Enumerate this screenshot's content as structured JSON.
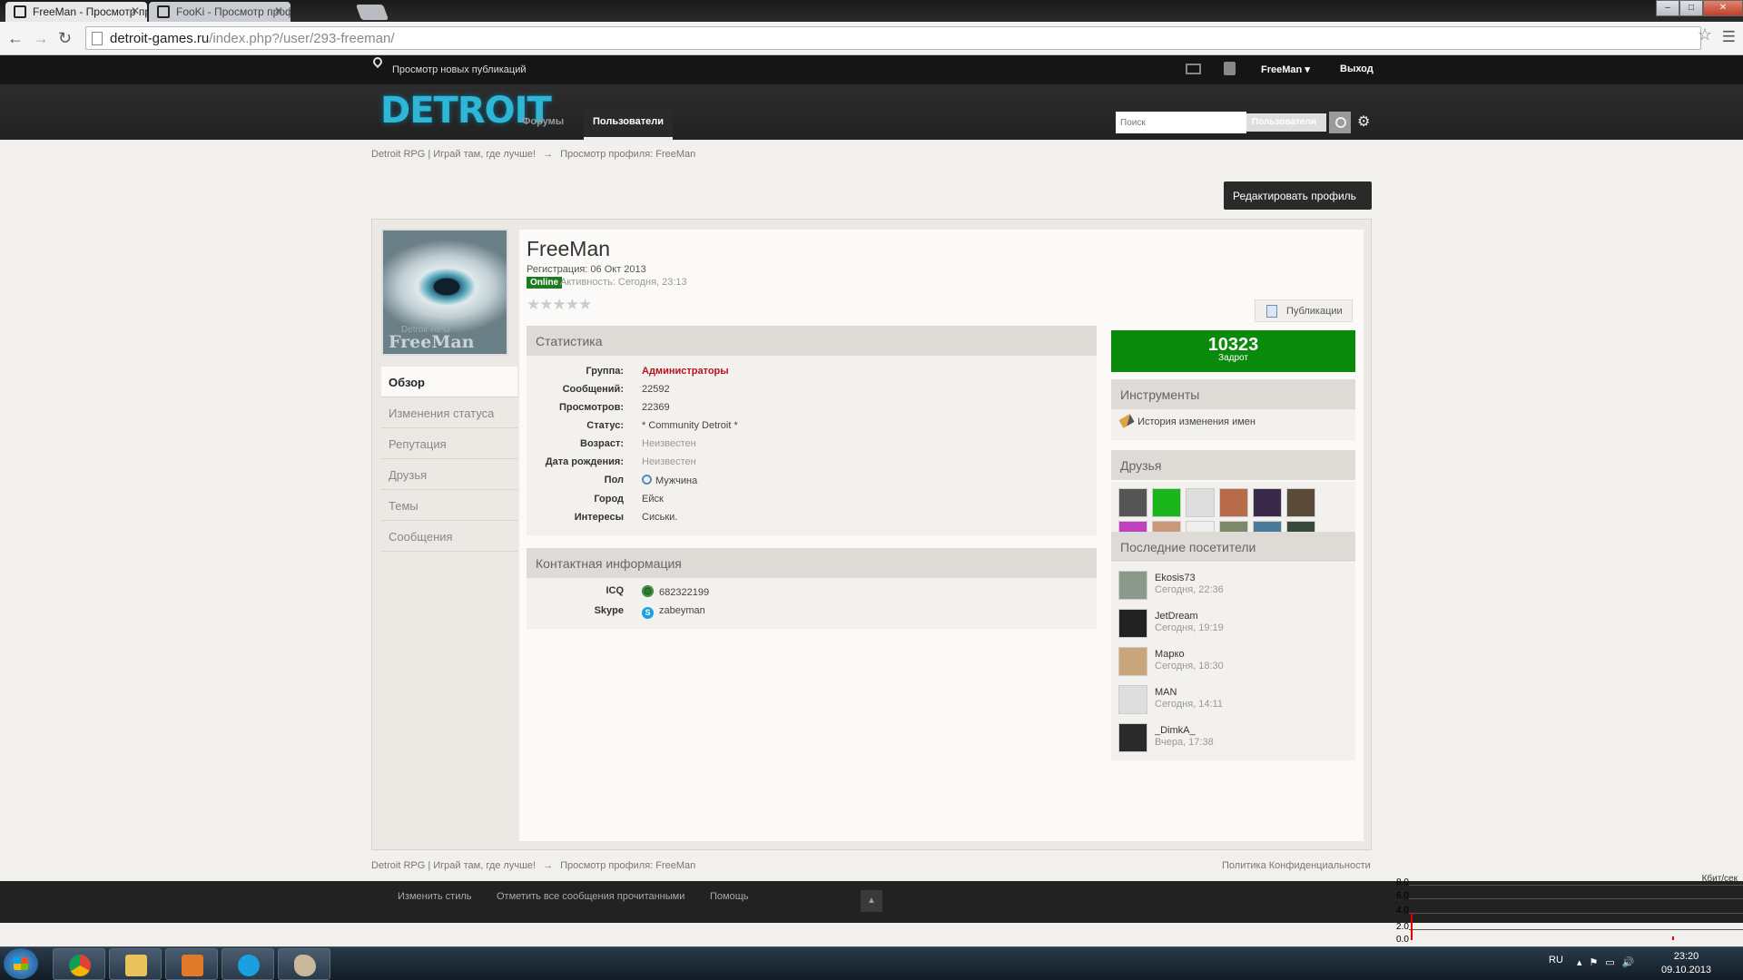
{
  "browser": {
    "tabs": [
      {
        "title": "FreeMan - Просмотр про"
      },
      {
        "title": "FooKi - Просмотр профи"
      }
    ],
    "url_domain": "detroit-games.ru",
    "url_path": "/index.php?/user/293-freeman/"
  },
  "topbar": {
    "new_content": "Просмотр новых публикаций",
    "username": "FreeMan",
    "logout": "Выход"
  },
  "header": {
    "logo": "DETROIT",
    "nav": [
      "Форумы",
      "Пользователи"
    ],
    "search_placeholder": "Поиск",
    "search_scope": "Пользователи"
  },
  "breadcrumb": {
    "home": "Detroit RPG | Играй там, где лучше!",
    "arrow": "→",
    "current": "Просмотр профиля: FreeMan"
  },
  "edit_profile": "Редактировать профиль",
  "profile": {
    "avatar_caption": "FreeMan",
    "avatar_subcaption": "Detroit RPG",
    "name": "FreeMan",
    "registered": "Регистрация: 06 Окт 2013",
    "status_badge": "Online",
    "activity": "Активность: Сегодня, 23:13",
    "stars": "★★★★★",
    "publications_btn": "Публикации",
    "menu": [
      "Обзор",
      "Изменения статуса",
      "Репутация",
      "Друзья",
      "Темы",
      "Сообщения"
    ]
  },
  "stats": {
    "title": "Статистика",
    "rows": [
      {
        "label": "Группа:",
        "value": "Администраторы"
      },
      {
        "label": "Сообщений:",
        "value": "22592"
      },
      {
        "label": "Просмотров:",
        "value": "22369"
      },
      {
        "label": "Статус:",
        "value": "* Community Detroit *"
      },
      {
        "label": "Возраст:",
        "value": "Неизвестен"
      },
      {
        "label": "Дата рождения:",
        "value": "Неизвестен"
      },
      {
        "label": "Пол",
        "value": "Мужчина"
      },
      {
        "label": "Город",
        "value": "Ейск"
      },
      {
        "label": "Интересы",
        "value": "Сиськи."
      }
    ]
  },
  "contact": {
    "title": "Контактная информация",
    "icq_label": "ICQ",
    "icq_value": "682322199",
    "skype_label": "Skype",
    "skype_value": "zabeyman"
  },
  "reputation": {
    "value": "10323",
    "label": "Задрот",
    "color": "#0a8a0a"
  },
  "tools": {
    "title": "Инструменты",
    "item": "История изменения имен"
  },
  "friends": {
    "title": "Друзья",
    "avatar_colors": [
      "#555",
      "#1ab51a",
      "#ddd",
      "#b86b4a",
      "#3a2a4a",
      "#5a4a3a",
      "#c040c0",
      "#c99a7a",
      "#eee",
      "#7a8a6a",
      "#4a7a9a",
      "#3a4a3a"
    ]
  },
  "visitors": {
    "title": "Последние посетители",
    "list": [
      {
        "name": "Ekosis73",
        "time": "Сегодня, 22:36",
        "color": "#8a9a8a"
      },
      {
        "name": "JetDream",
        "time": "Сегодня, 19:19",
        "color": "#222"
      },
      {
        "name": "Марко",
        "time": "Сегодня, 18:30",
        "color": "#c9a57a"
      },
      {
        "name": "MAN",
        "time": "Сегодня, 14:11",
        "color": "#ddd"
      },
      {
        "name": "_DimkA_",
        "time": "Вчера, 17:38",
        "color": "#2a2a2a"
      }
    ]
  },
  "footer": {
    "change_style": "Изменить стиль",
    "mark_read": "Отметить все сообщения прочитанными",
    "help": "Помощь",
    "privacy": "Политика Конфиденциальности",
    "to_top": "▲"
  },
  "netmeter": {
    "unit": "Кбит/сек",
    "scale": [
      "8.0",
      "6.0",
      "4.0",
      "2.0",
      "0.0"
    ]
  },
  "taskbar": {
    "lang": "RU",
    "time": "23:20",
    "date": "09.10.2013"
  }
}
